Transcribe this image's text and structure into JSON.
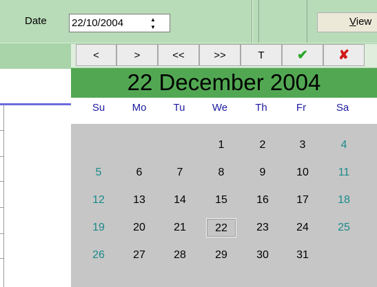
{
  "toolbar": {
    "date_label": "Date",
    "date_value": "22/10/2004",
    "view_label_first": "V",
    "view_label_rest": "iew"
  },
  "calendar": {
    "nav": {
      "prev_month": "<",
      "next_month": ">",
      "prev_year": "<<",
      "next_year": ">>",
      "today": "T",
      "ok": "✔",
      "cancel": "✘"
    },
    "title": "22 December 2004",
    "weekdays": [
      "Su",
      "Mo",
      "Tu",
      "We",
      "Th",
      "Fr",
      "Sa"
    ],
    "weeks": [
      [
        "",
        "",
        "",
        "1",
        "2",
        "3",
        "4"
      ],
      [
        "5",
        "6",
        "7",
        "8",
        "9",
        "10",
        "11"
      ],
      [
        "12",
        "13",
        "14",
        "15",
        "16",
        "17",
        "18"
      ],
      [
        "19",
        "20",
        "21",
        "22",
        "23",
        "24",
        "25"
      ],
      [
        "26",
        "27",
        "28",
        "29",
        "30",
        "31",
        ""
      ]
    ],
    "selected_day": "22",
    "colors": {
      "title_bg": "#52a852",
      "weekday_text": "#1a1aa0",
      "weekend_text": "#1a8a8a",
      "grid_bg": "#c6c6c6",
      "ok_icon": "#2aa52a",
      "cancel_icon": "#d01818"
    }
  }
}
